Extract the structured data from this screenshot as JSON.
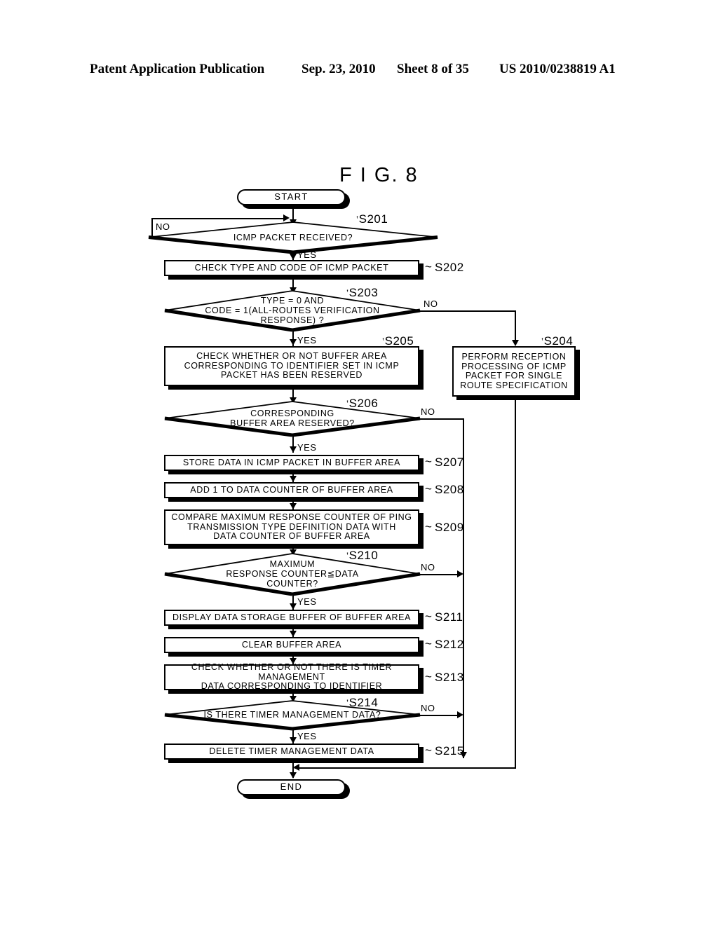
{
  "header": {
    "title": "Patent Application Publication",
    "date": "Sep. 23, 2010",
    "sheet": "Sheet 8 of 35",
    "publication_number": "US 2010/0238819 A1"
  },
  "figure": {
    "title": "F I G. 8"
  },
  "flowchart": {
    "start": {
      "label": "START"
    },
    "end": {
      "label": "END"
    },
    "nodes": [
      {
        "id": "S201",
        "type": "decision",
        "text": "ICMP PACKET RECEIVED?"
      },
      {
        "id": "S202",
        "type": "process",
        "text": "CHECK TYPE AND CODE OF ICMP PACKET"
      },
      {
        "id": "S203",
        "type": "decision",
        "text": "TYPE = 0 AND\nCODE = 1(ALL-ROUTES VERIFICATION\nRESPONSE) ?"
      },
      {
        "id": "S204",
        "type": "process",
        "text": "PERFORM RECEPTION\nPROCESSING OF ICMP\nPACKET FOR SINGLE\nROUTE SPECIFICATION"
      },
      {
        "id": "S205",
        "type": "process",
        "text": "CHECK WHETHER OR NOT BUFFER AREA\nCORRESPONDING TO IDENTIFIER SET IN ICMP\nPACKET HAS BEEN RESERVED"
      },
      {
        "id": "S206",
        "type": "decision",
        "text": "CORRESPONDING\nBUFFER AREA RESERVED?"
      },
      {
        "id": "S207",
        "type": "process",
        "text": "STORE DATA IN ICMP PACKET IN BUFFER AREA"
      },
      {
        "id": "S208",
        "type": "process",
        "text": "ADD 1 TO DATA COUNTER OF BUFFER AREA"
      },
      {
        "id": "S209",
        "type": "process",
        "text": "COMPARE MAXIMUM RESPONSE COUNTER OF PING\nTRANSMISSION TYPE DEFINITION DATA WITH\nDATA COUNTER OF BUFFER AREA"
      },
      {
        "id": "S210",
        "type": "decision",
        "text": "MAXIMUM\nRESPONSE COUNTER≦DATA\nCOUNTER?"
      },
      {
        "id": "S211",
        "type": "process",
        "text": "DISPLAY DATA STORAGE BUFFER OF BUFFER AREA"
      },
      {
        "id": "S212",
        "type": "process",
        "text": "CLEAR BUFFER AREA"
      },
      {
        "id": "S213",
        "type": "process",
        "text": "CHECK WHETHER OR NOT THERE IS TIMER MANAGEMENT\nDATA CORRESPONDING TO IDENTIFIER"
      },
      {
        "id": "S214",
        "type": "decision",
        "text": "IS THERE TIMER MANAGEMENT DATA?"
      },
      {
        "id": "S215",
        "type": "process",
        "text": "DELETE TIMER MANAGEMENT DATA"
      }
    ],
    "branch_labels": {
      "s201_no": "NO",
      "s201_yes": "YES",
      "s203_no": "NO",
      "s203_yes": "YES",
      "s206_no": "NO",
      "s206_yes": "YES",
      "s210_no": "NO",
      "s210_yes": "YES",
      "s214_no": "NO",
      "s214_yes": "YES"
    },
    "step_id_prefix": "~"
  }
}
